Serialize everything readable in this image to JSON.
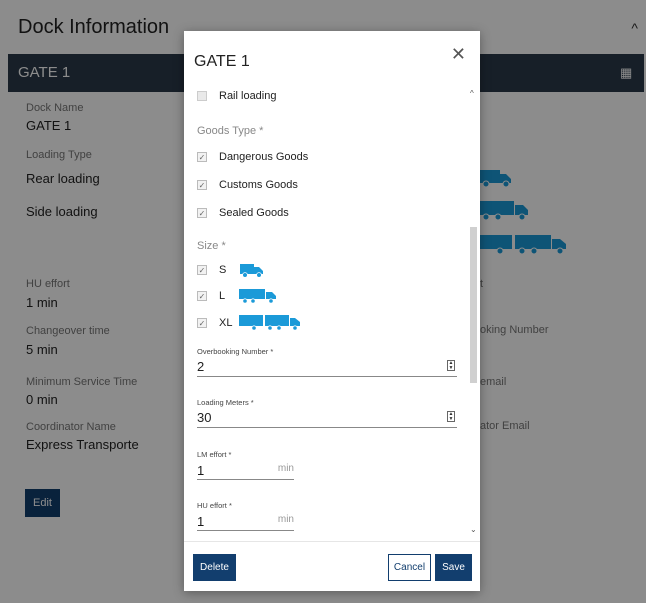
{
  "background": {
    "page_title": "Dock Information",
    "gate_band_title": "GATE 1",
    "fields": [
      {
        "label": "Dock Name",
        "value": "GATE 1"
      },
      {
        "label": "Loading Type",
        "value": "Rear loading"
      },
      {
        "label": "",
        "value": "Side loading"
      },
      {
        "label": "HU effort",
        "value": "1 min"
      },
      {
        "label": "Changeover time",
        "value": "5 min"
      },
      {
        "label": "Minimum Service Time",
        "value": "0 min"
      },
      {
        "label": "Coordinator Name",
        "value": "Express Transporte"
      }
    ],
    "partial_labels": [
      "t",
      "oking Number",
      "email",
      "ator Email"
    ],
    "edit_label": "Edit"
  },
  "modal": {
    "title": "GATE 1",
    "loading": {
      "rail_label": "Rail loading",
      "rail_checked": false
    },
    "goods_type": {
      "label": "Goods Type *",
      "items": [
        {
          "label": "Dangerous Goods",
          "checked": true
        },
        {
          "label": "Customs Goods",
          "checked": true
        },
        {
          "label": "Sealed Goods",
          "checked": true
        }
      ]
    },
    "size": {
      "label": "Size *",
      "items": [
        {
          "label": "S",
          "checked": true,
          "icon": "van-icon"
        },
        {
          "label": "L",
          "checked": true,
          "icon": "truck-icon"
        },
        {
          "label": "XL",
          "checked": true,
          "icon": "truck-trailer-icon"
        }
      ]
    },
    "overbooking": {
      "label": "Overbooking Number *",
      "value": "2"
    },
    "loading_meters": {
      "label": "Loading Meters *",
      "value": "30"
    },
    "lm_effort": {
      "label": "LM effort *",
      "value": "1",
      "unit": "min"
    },
    "hu_effort": {
      "label": "HU effort *",
      "value": "1",
      "unit": "min"
    },
    "footer": {
      "delete_label": "Delete",
      "cancel_label": "Cancel",
      "save_label": "Save"
    }
  },
  "colors": {
    "primary": "#123e6e",
    "truck_blue": "#1b9ad8",
    "gate_band": "#2a3a4a"
  }
}
